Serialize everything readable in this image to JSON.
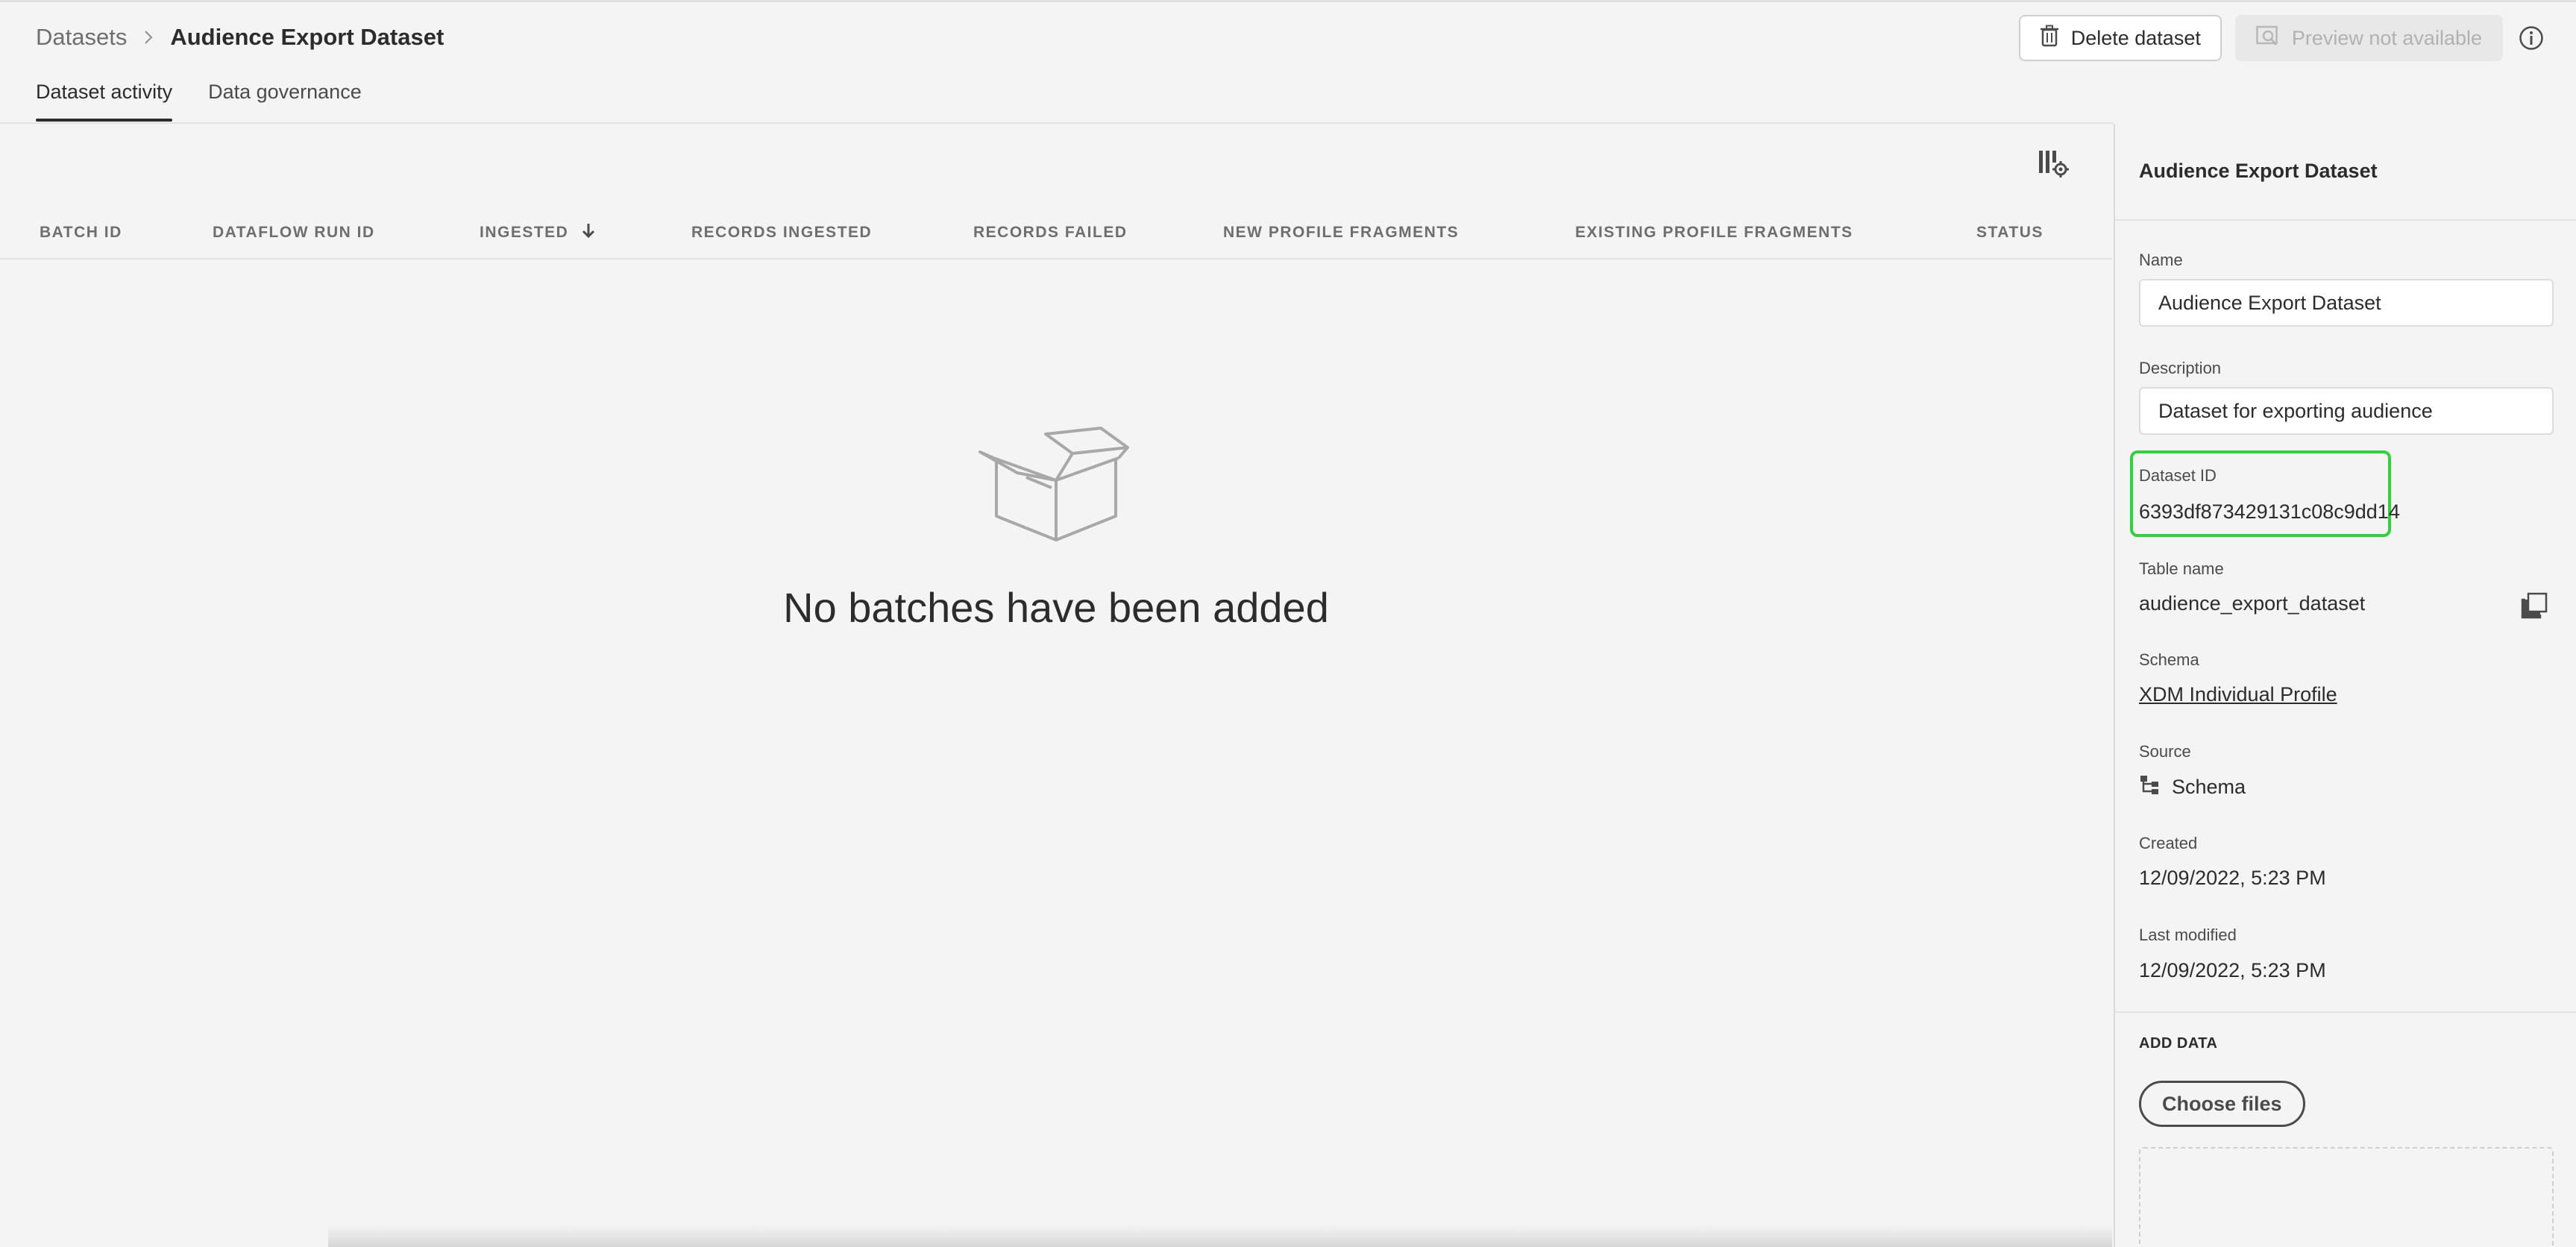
{
  "breadcrumb": {
    "parent": "Datasets",
    "current": "Audience Export Dataset"
  },
  "header": {
    "delete_label": "Delete dataset",
    "preview_label": "Preview not available"
  },
  "tabs": [
    {
      "label": "Dataset activity",
      "active": true
    },
    {
      "label": "Data governance",
      "active": false
    }
  ],
  "table": {
    "columns": [
      "BATCH ID",
      "DATAFLOW RUN ID",
      "INGESTED",
      "RECORDS INGESTED",
      "RECORDS FAILED",
      "NEW PROFILE FRAGMENTS",
      "EXISTING PROFILE FRAGMENTS",
      "STATUS"
    ],
    "sorted_column": "INGESTED",
    "sort_direction": "descending",
    "empty_message": "No batches have been added"
  },
  "rail": {
    "title": "Audience Export Dataset",
    "name_label": "Name",
    "name_value": "Audience Export Dataset",
    "description_label": "Description",
    "description_value": "Dataset for exporting audience",
    "dataset_id_label": "Dataset ID",
    "dataset_id_value": "6393df873429131c08c9dd14",
    "table_name_label": "Table name",
    "table_name_value": "audience_export_dataset",
    "schema_label": "Schema",
    "schema_value": "XDM Individual Profile",
    "source_label": "Source",
    "source_value": "Schema",
    "created_label": "Created",
    "created_value": "12/09/2022, 5:23 PM",
    "last_modified_label": "Last modified",
    "last_modified_value": "12/09/2022, 5:23 PM",
    "add_data_label": "ADD DATA",
    "choose_files_label": "Choose files"
  },
  "colors": {
    "highlight": "#2fd339",
    "background": "#f4f4f4",
    "text": "#2c2c2c"
  }
}
